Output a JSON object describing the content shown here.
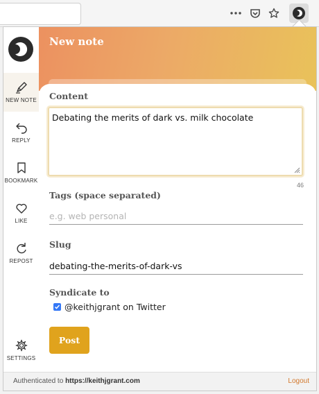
{
  "browser": {
    "menu_icon": "ellipsis-icon",
    "pocket_icon": "pocket-icon",
    "bookmark_icon": "star-icon",
    "extension_icon": "micropub-logo-icon"
  },
  "sidebar": {
    "items": [
      {
        "label": "NEW NOTE",
        "icon": "pen-icon"
      },
      {
        "label": "REPLY",
        "icon": "reply-icon"
      },
      {
        "label": "BOOKMARK",
        "icon": "bookmark-icon"
      },
      {
        "label": "LIKE",
        "icon": "heart-icon"
      },
      {
        "label": "REPOST",
        "icon": "repost-icon"
      }
    ],
    "settings": {
      "label": "SETTINGS",
      "icon": "gear-icon"
    }
  },
  "header": {
    "title": "New note"
  },
  "form": {
    "content_label": "Content",
    "content_value": "Debating the merits of dark vs. milk chocolate",
    "char_count": "46",
    "tags_label": "Tags (space separated)",
    "tags_placeholder": "e.g. web  personal",
    "slug_label": "Slug",
    "slug_value": "debating-the-merits-of-dark-vs",
    "syndicate_label": "Syndicate to",
    "syndicate_option": "@keithjgrant on Twitter",
    "syndicate_checked": true,
    "post_label": "Post"
  },
  "footer": {
    "auth_prefix": "Authenticated to",
    "auth_site": "https://keithjgrant.com",
    "logout_label": "Logout"
  },
  "colors": {
    "accent": "#e0a31d",
    "logout": "#d2782c",
    "header_start": "#ec9160",
    "header_end": "#e9c25a",
    "checkbox": "#3478f6"
  }
}
